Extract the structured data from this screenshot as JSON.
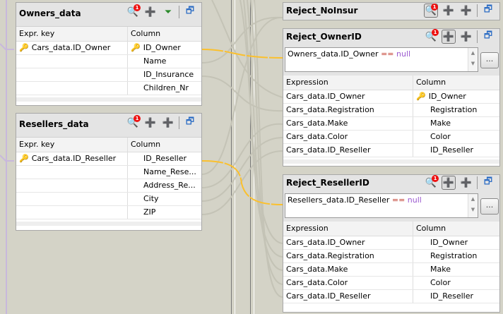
{
  "left_tables": [
    {
      "title": "Owners_data",
      "headers": [
        "Expr. key",
        "Column"
      ],
      "rows": [
        {
          "expr": "Cars_data.ID_Owner",
          "column": "ID_Owner",
          "key": true
        },
        {
          "expr": "",
          "column": "Name"
        },
        {
          "expr": "",
          "column": "ID_Insurance"
        },
        {
          "expr": "",
          "column": "Children_Nr"
        }
      ]
    },
    {
      "title": "Resellers_data",
      "headers": [
        "Expr. key",
        "Column"
      ],
      "rows": [
        {
          "expr": "Cars_data.ID_Reseller",
          "column": "ID_Reseller"
        },
        {
          "expr": "",
          "column": "Name_Rese..."
        },
        {
          "expr": "",
          "column": "Address_Re..."
        },
        {
          "expr": "",
          "column": "City"
        },
        {
          "expr": "",
          "column": "ZIP"
        }
      ]
    }
  ],
  "outputs": [
    {
      "title": "Reject_NoInsur"
    },
    {
      "title": "Reject_OwnerID",
      "filter": {
        "lhs": "Owners_data.ID_Owner",
        "op": "==",
        "rhs": "null"
      },
      "more": "...",
      "headers": [
        "Expression",
        "Column"
      ],
      "rows": [
        {
          "expr": "Cars_data.ID_Owner",
          "column": "ID_Owner"
        },
        {
          "expr": "Cars_data.Registration",
          "column": "Registration"
        },
        {
          "expr": "Cars_data.Make",
          "column": "Make"
        },
        {
          "expr": "Cars_data.Color",
          "column": "Color"
        },
        {
          "expr": "Cars_data.ID_Reseller",
          "column": "ID_Reseller"
        }
      ]
    },
    {
      "title": "Reject_ResellerID",
      "filter": {
        "lhs": "Resellers_data.ID_Reseller",
        "op": "==",
        "rhs": "null"
      },
      "more": "...",
      "headers": [
        "Expression",
        "Column"
      ],
      "rows": [
        {
          "expr": "Cars_data.ID_Owner",
          "column": "ID_Owner"
        },
        {
          "expr": "Cars_data.Registration",
          "column": "Registration"
        },
        {
          "expr": "Cars_data.Make",
          "column": "Make"
        },
        {
          "expr": "Cars_data.Color",
          "column": "Color"
        },
        {
          "expr": "Cars_data.ID_Reseller",
          "column": "ID_Reseller"
        }
      ]
    }
  ],
  "badge": "1",
  "colors": {
    "link": "#fbc02d",
    "bg": "#d4d3c7"
  }
}
